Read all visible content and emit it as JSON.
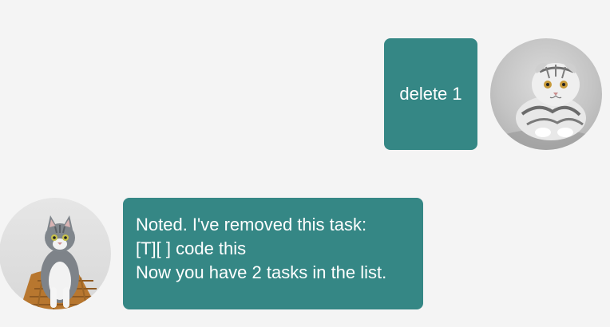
{
  "chat": {
    "messages": [
      {
        "sender": "user",
        "avatar_icon": "cat-scottish-fold-avatar-icon",
        "text": "delete 1"
      },
      {
        "sender": "bot",
        "avatar_icon": "cat-tabby-avatar-icon",
        "lines": [
          "Noted. I've removed this task:",
          "[T][ ] code this",
          "Now you have 2 tasks in the list."
        ]
      }
    ]
  },
  "colors": {
    "background": "#f4f4f4",
    "bubble": "#358785",
    "bubble_text": "#ffffff"
  }
}
